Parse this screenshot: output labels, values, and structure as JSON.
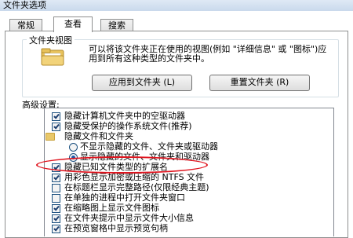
{
  "window": {
    "title": "文件夹选项"
  },
  "tabs": [
    {
      "label": "常规"
    },
    {
      "label": "查看"
    },
    {
      "label": "搜索"
    }
  ],
  "folder_views": {
    "legend": "文件夹视图",
    "description": "可以将该文件夹正在使用的视图(例如 \"详细信息\" 或 \"图标\")应用到所有这种类型的文件夹中。",
    "apply_button": "应用到文件夹 (L)",
    "reset_button": "重置文件夹 (R)",
    "icon": "folder-icon"
  },
  "advanced": {
    "label": "高级设置:",
    "items": [
      {
        "kind": "checkbox",
        "checked": true,
        "indent": 1,
        "label": "隐藏计算机文件夹中的空驱动器"
      },
      {
        "kind": "checkbox",
        "checked": true,
        "indent": 1,
        "label": "隐藏受保护的操作系统文件(推荐)"
      },
      {
        "kind": "folder",
        "indent": 0,
        "label": "隐藏文件和文件夹"
      },
      {
        "kind": "radio",
        "selected": false,
        "indent": 2,
        "label": "不显示隐藏的文件、文件夹或驱动器"
      },
      {
        "kind": "radio",
        "selected": true,
        "indent": 2,
        "label": "显示隐藏的文件、文件夹和驱动器"
      },
      {
        "kind": "checkbox",
        "checked": true,
        "indent": 1,
        "label": "隐藏已知文件类型的扩展名"
      },
      {
        "kind": "checkbox",
        "checked": true,
        "indent": 1,
        "label": "用彩色显示加密或压缩的 NTFS 文件"
      },
      {
        "kind": "checkbox",
        "checked": false,
        "indent": 1,
        "label": "在标题栏显示完整路径(仅限经典主题)"
      },
      {
        "kind": "checkbox",
        "checked": false,
        "indent": 1,
        "label": "在单独的进程中打开文件夹窗口"
      },
      {
        "kind": "checkbox",
        "checked": true,
        "indent": 1,
        "label": "在缩略图上显示文件图标"
      },
      {
        "kind": "checkbox",
        "checked": true,
        "indent": 1,
        "label": "在文件夹提示中显示文件大小信息"
      },
      {
        "kind": "checkbox",
        "checked": true,
        "indent": 1,
        "label": "在预览窗格中显示预览句柄"
      }
    ]
  },
  "colors": {
    "highlight": "#e0141e",
    "checkbox_border": "#1c5180",
    "radio_dot": "#1e58a8"
  }
}
